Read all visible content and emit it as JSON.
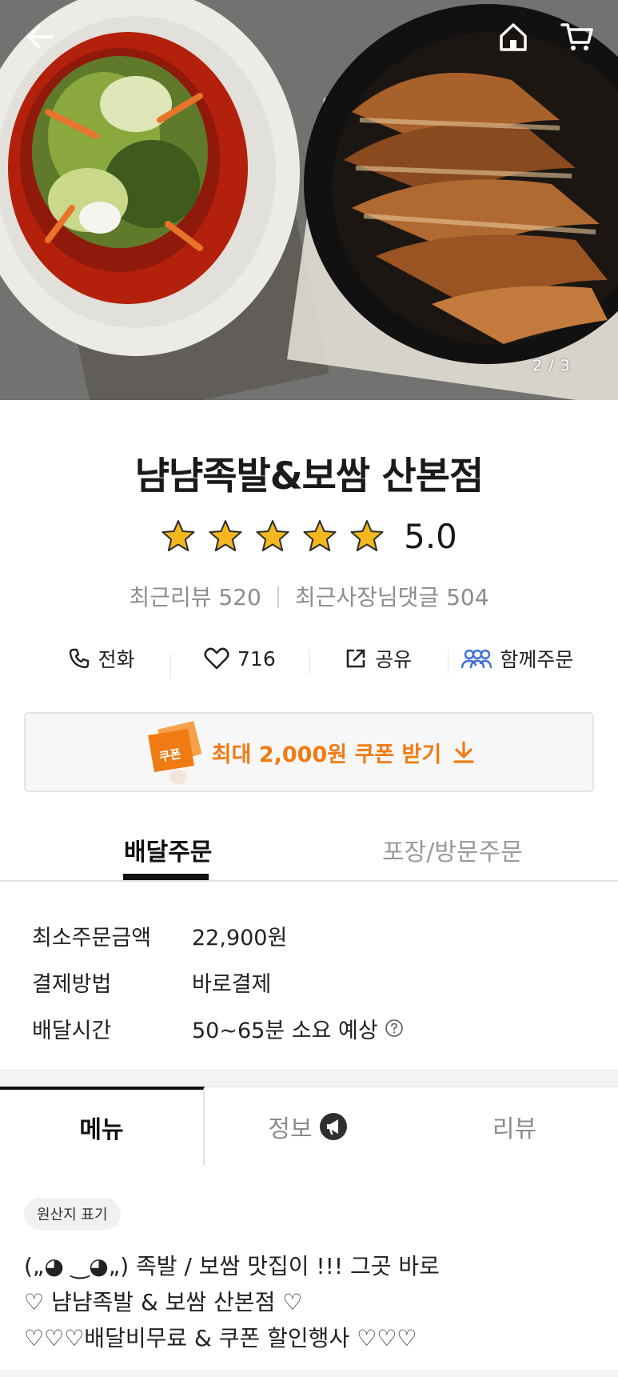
{
  "hero": {
    "pager": "2 / 3",
    "icons": [
      "back-arrow-icon",
      "home-icon",
      "cart-icon"
    ]
  },
  "store": {
    "name": "냠냠족발&보쌈 산본점",
    "rating": "5.0",
    "star_count": 5,
    "recent_reviews": "최근리뷰 520",
    "owner_replies": "최근사장님댓글 504"
  },
  "actions": {
    "call": "전화",
    "likes": "716",
    "share": "공유",
    "group_order": "함께주문"
  },
  "coupon": {
    "badge": "쿠폰",
    "label": "최대 2,000원 쿠폰 받기"
  },
  "order_tabs": {
    "delivery": "배달주문",
    "pickup": "포장/방문주문"
  },
  "order_info": {
    "min_order_label": "최소주문금액",
    "min_order_value": "22,900원",
    "payment_label": "결제방법",
    "payment_value": "바로결제",
    "delivery_time_label": "배달시간",
    "delivery_time_value": "50~65분 소요 예상"
  },
  "menu_tabs": {
    "menu": "메뉴",
    "info": "정보",
    "review": "리뷰"
  },
  "origin_chip": "원산지 표기",
  "intro": {
    "line1": "(„◕ ‿◕„) 족발 / 보쌈 맛집이 !!! 그곳 바로",
    "line2": "♡ 냠냠족발 & 보쌈 산본점 ♡",
    "line3": "♡♡♡배달비무료 & 쿠폰 할인행사 ♡♡♡"
  },
  "colors": {
    "accent_orange": "#f07b12",
    "star_yellow": "#f5b81c",
    "group_blue": "#3b6fd8"
  }
}
